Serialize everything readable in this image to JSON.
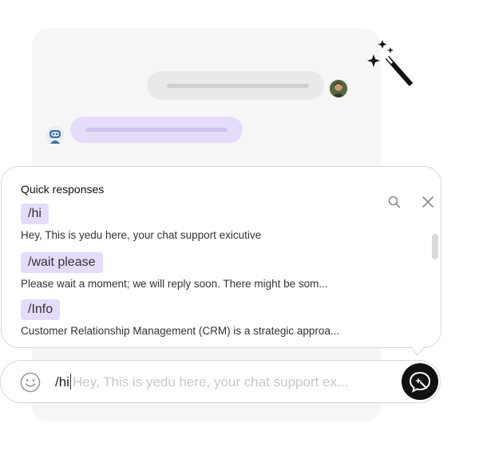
{
  "quick_responses": {
    "title": "Quick responses",
    "items": [
      {
        "tag": "/hi",
        "description": "Hey, This is yedu here, your chat support exicutive"
      },
      {
        "tag": "/wait please",
        "description": "Please wait a moment; we will reply soon. There might be som..."
      },
      {
        "tag": "/Info",
        "description": "Customer Relationship Management (CRM) is a strategic approa..."
      }
    ]
  },
  "composer": {
    "typed_text": "/hi",
    "suggestion": "Hey, This is yedu here, your chat support ex..."
  },
  "icons": {
    "search": "search-icon",
    "close": "close-icon",
    "emoji": "smiley-icon",
    "send": "chat-magic-icon",
    "decoration": "magic-wand-icon"
  },
  "colors": {
    "accent_purple": "#e5dbfa",
    "send_button": "#111111"
  }
}
